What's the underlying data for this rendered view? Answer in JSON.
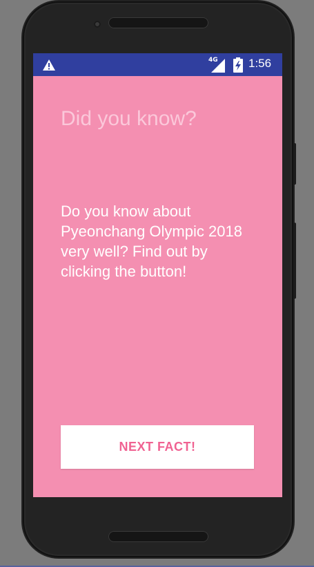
{
  "statusbar": {
    "network_label": "4G",
    "time": "1:56",
    "icons": [
      "warning-icon",
      "signal-icon",
      "battery-charging-icon"
    ]
  },
  "main": {
    "headline": "Did you know?",
    "fact_text": "Do you know about Pyeonchang Olympic 2018 very well? Find out by clicking the button!",
    "next_button_label": "NEXT FACT!"
  },
  "colors": {
    "statusbar_bg": "#303f9f",
    "screen_bg": "#f48fb1",
    "headline_text": "#fbc8da",
    "button_bg": "#ffffff",
    "button_text": "#f06292"
  }
}
